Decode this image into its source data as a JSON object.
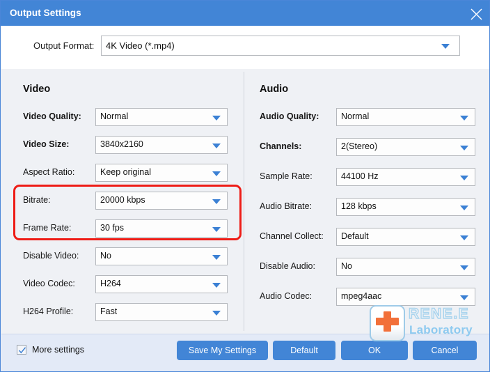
{
  "window": {
    "title": "Output Settings",
    "close_icon": "close-icon",
    "accent_color": "#4285d6",
    "highlight_color": "#ee1c16",
    "body_background": "#eff1f5",
    "footer_background": "#e3eaf7"
  },
  "output_format": {
    "label": "Output Format:",
    "value": "4K Video (*.mp4)"
  },
  "video": {
    "title": "Video",
    "rows": [
      {
        "label": "Video Quality:",
        "value": "Normal",
        "bold": true,
        "highlighted": false
      },
      {
        "label": "Video Size:",
        "value": "3840x2160",
        "bold": true,
        "highlighted": false
      },
      {
        "label": "Aspect Ratio:",
        "value": "Keep original",
        "bold": false,
        "highlighted": false
      },
      {
        "label": "Bitrate:",
        "value": "20000 kbps",
        "bold": false,
        "highlighted": true
      },
      {
        "label": "Frame Rate:",
        "value": "30 fps",
        "bold": false,
        "highlighted": true
      },
      {
        "label": "Disable Video:",
        "value": "No",
        "bold": false,
        "highlighted": false
      },
      {
        "label": "Video Codec:",
        "value": "H264",
        "bold": false,
        "highlighted": false
      },
      {
        "label": "H264 Profile:",
        "value": "Fast",
        "bold": false,
        "highlighted": false
      }
    ]
  },
  "audio": {
    "title": "Audio",
    "rows": [
      {
        "label": "Audio Quality:",
        "value": "Normal",
        "bold": true
      },
      {
        "label": "Channels:",
        "value": "2(Stereo)",
        "bold": true
      },
      {
        "label": "Sample Rate:",
        "value": "44100 Hz",
        "bold": false
      },
      {
        "label": "Audio Bitrate:",
        "value": "128 kbps",
        "bold": false
      },
      {
        "label": "Channel Collect:",
        "value": "Default",
        "bold": false
      },
      {
        "label": "Disable Audio:",
        "value": "No",
        "bold": false
      },
      {
        "label": "Audio Codec:",
        "value": "mpeg4aac",
        "bold": false
      }
    ]
  },
  "footer": {
    "more_settings_label": "More settings",
    "more_settings_checked": true,
    "buttons": {
      "save": "Save My Settings",
      "default": "Default",
      "ok": "OK",
      "cancel": "Cancel"
    }
  },
  "watermark": {
    "brand": "RENE.E",
    "sub": "Laboratory",
    "cross_color": "#f2703a",
    "text_color": "#8ecaf0"
  }
}
